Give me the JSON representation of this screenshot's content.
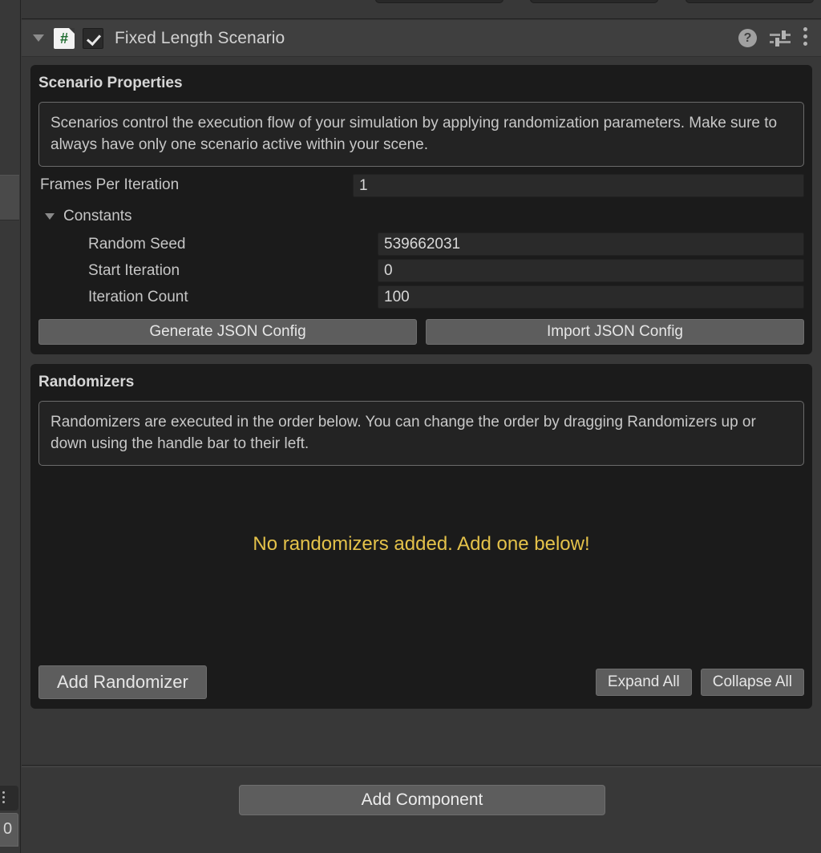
{
  "window": {
    "background_color": "#383838",
    "panel_color": "#1b1b1b",
    "accent_warning_color": "#e4c24a",
    "script_icon_color": "#1d6b2e"
  },
  "top_cut_row": {
    "stubs": [
      {
        "label": ""
      },
      {
        "label": ""
      },
      {
        "label": ""
      }
    ]
  },
  "left_gutter": {
    "partial_field_value": "0"
  },
  "component": {
    "title": "Fixed Length Scenario",
    "enabled": true,
    "expanded": true,
    "script_icon_glyph": "#",
    "icons": {
      "help": "?",
      "preset": "preset-sliders",
      "menu": "kebab-menu"
    }
  },
  "scenario_properties": {
    "title": "Scenario Properties",
    "help_text": "Scenarios control the execution flow of your simulation by applying randomization parameters. Make sure to always have only one scenario active within your scene.",
    "frames_per_iteration": {
      "label": "Frames Per Iteration",
      "value": "1"
    },
    "constants": {
      "label": "Constants",
      "expanded": true,
      "fields": [
        {
          "label": "Random Seed",
          "value": "539662031"
        },
        {
          "label": "Start Iteration",
          "value": "0"
        },
        {
          "label": "Iteration Count",
          "value": "100"
        }
      ]
    },
    "buttons": {
      "generate": "Generate JSON Config",
      "import": "Import JSON Config"
    }
  },
  "randomizers": {
    "title": "Randomizers",
    "help_text": "Randomizers are executed in the order below. You can change the order by dragging Randomizers up or down using the handle bar to their left.",
    "empty_message": "No randomizers added. Add one below!",
    "buttons": {
      "add": "Add Randomizer",
      "expand_all": "Expand All",
      "collapse_all": "Collapse All"
    }
  },
  "footer": {
    "add_component": "Add Component"
  }
}
